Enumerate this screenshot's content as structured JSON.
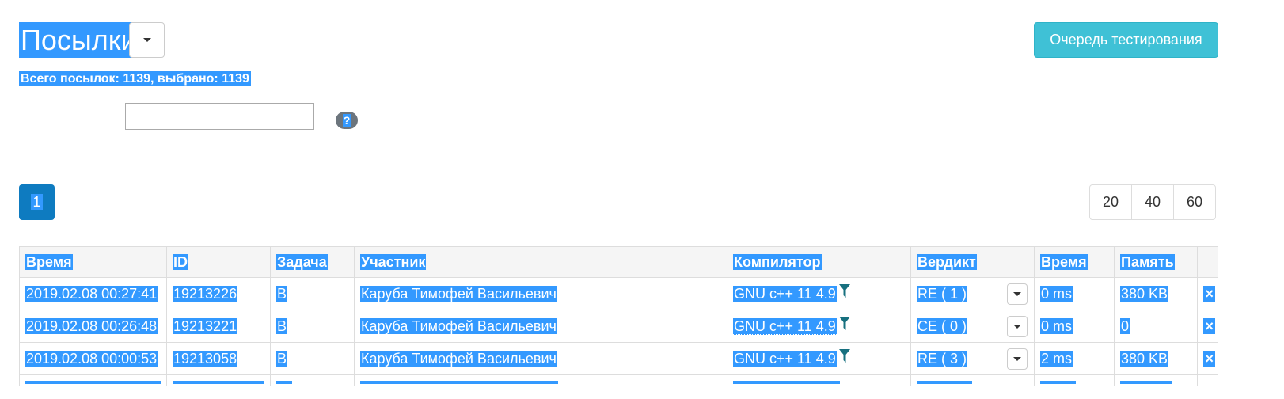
{
  "header": {
    "title": "Посылки",
    "queue_button": "Очередь тестирования",
    "summary": "Всего посылок: 1139, выбрано: 1139"
  },
  "filter": {
    "value": "",
    "help_label": "?"
  },
  "pagination": {
    "current_page": "1",
    "per_page_options": [
      "20",
      "40",
      "60"
    ]
  },
  "table": {
    "headers": [
      "Время",
      "ID",
      "Задача",
      "Участник",
      "Компилятор",
      "Вердикт",
      "Время",
      "Память"
    ],
    "rows": [
      {
        "time": "2019.02.08 00:27:41",
        "id": "19213226",
        "task": "B",
        "participant": "Каруба Тимофей Васильевич",
        "compiler": "GNU c++ 11 4.9",
        "verdict": "RE ( 1 )",
        "run_time": "0 ms",
        "memory": "380 KB",
        "delete": "×"
      },
      {
        "time": "2019.02.08 00:26:48",
        "id": "19213221",
        "task": "B",
        "participant": "Каруба Тимофей Васильевич",
        "compiler": "GNU c++ 11 4.9",
        "verdict": "CE ( 0 )",
        "run_time": "0 ms",
        "memory": "0",
        "delete": "×"
      },
      {
        "time": "2019.02.08 00:00:53",
        "id": "19213058",
        "task": "B",
        "participant": "Каруба Тимофей Васильевич",
        "compiler": "GNU c++ 11 4.9",
        "verdict": "RE ( 3 )",
        "run_time": "2 ms",
        "memory": "380 KB",
        "delete": "×"
      }
    ]
  },
  "colors": {
    "selection": "#3399ff",
    "info_button": "#3fc1d6",
    "active_page": "#0e7bc0",
    "filter_icon": "#17707f"
  }
}
